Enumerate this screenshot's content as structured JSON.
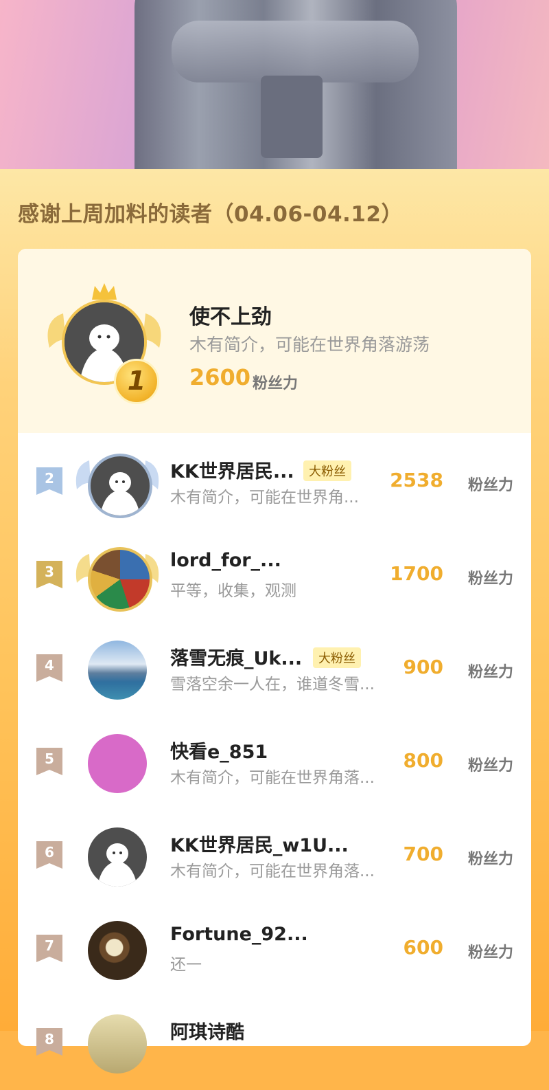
{
  "heading": "感谢上周加料的读者（04.06-04.12）",
  "champion": {
    "rank": "1",
    "name": "使不上劲",
    "intro": "木有简介，可能在世界角落游荡",
    "score": "2600",
    "unit": "粉丝力"
  },
  "rows": [
    {
      "rank": "2",
      "name": "KK世界居民...",
      "tag": "大粉丝",
      "intro": "木有简介，可能在世界角...",
      "score": "2538",
      "unit": "粉丝力"
    },
    {
      "rank": "3",
      "name": "lord_for_...",
      "tag": "",
      "intro": "平等，收集，观测",
      "score": "1700",
      "unit": "粉丝力"
    },
    {
      "rank": "4",
      "name": "落雪无痕_Uk...",
      "tag": "大粉丝",
      "intro": "雪落空余一人在，谁道冬雪...",
      "score": "900",
      "unit": "粉丝力"
    },
    {
      "rank": "5",
      "name": "快看e_851",
      "tag": "",
      "intro": "木有简介，可能在世界角落...",
      "score": "800",
      "unit": "粉丝力"
    },
    {
      "rank": "6",
      "name": "KK世界居民_w1U...",
      "tag": "",
      "intro": "木有简介，可能在世界角落...",
      "score": "700",
      "unit": "粉丝力"
    },
    {
      "rank": "7",
      "name": "Fortune_92...",
      "tag": "",
      "intro": "还一",
      "score": "600",
      "unit": "粉丝力"
    },
    {
      "rank": "8",
      "name": "阿琪诗酷",
      "tag": "",
      "intro": "",
      "score": "",
      "unit": ""
    }
  ],
  "colors": {
    "accent": "#f0ad2e",
    "rank2": "#a9c4e4",
    "rank3": "#d4b25a",
    "rank_other": "#c9ad9c"
  }
}
